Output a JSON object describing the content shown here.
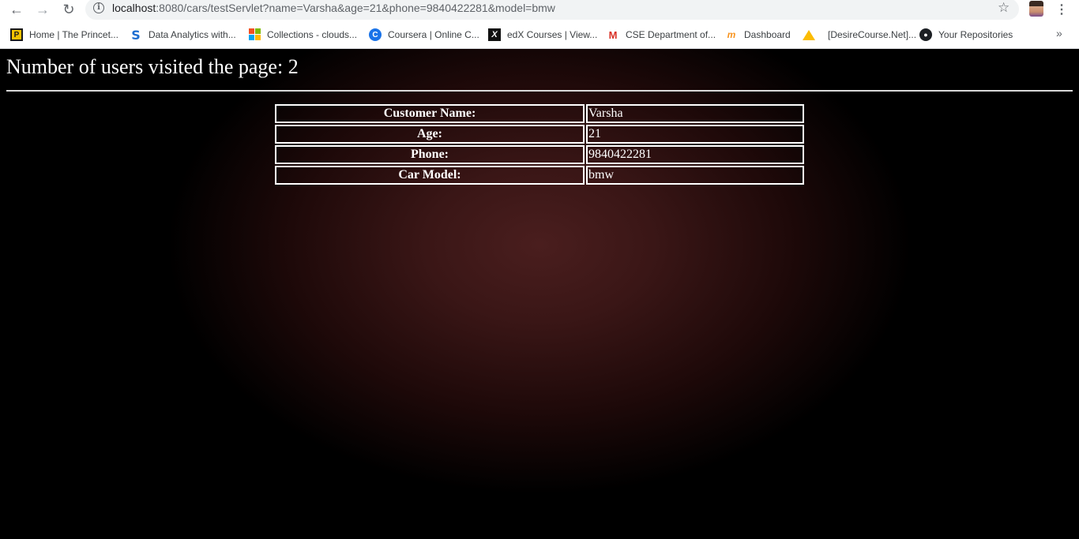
{
  "browser": {
    "url_host": "localhost",
    "url_rest": ":8080/cars/testServlet?name=Varsha&age=21&phone=9840422281&model=bmw",
    "bookmarks": [
      {
        "label": "Home | The Princet...",
        "icon": "princeton-review-icon"
      },
      {
        "label": "Data Analytics with...",
        "icon": "s-logo-icon"
      },
      {
        "label": "Collections - clouds...",
        "icon": "microsoft-logo-icon"
      },
      {
        "label": "Coursera | Online C...",
        "icon": "coursera-icon"
      },
      {
        "label": "edX Courses | View...",
        "icon": "edx-icon"
      },
      {
        "label": "CSE Department of...",
        "icon": "gmail-icon"
      },
      {
        "label": "Dashboard",
        "icon": "moodle-icon"
      },
      {
        "label": "[DesireCourse.Net]...",
        "icon": "google-drive-icon"
      },
      {
        "label": "Your Repositories",
        "icon": "github-icon"
      }
    ]
  },
  "page": {
    "heading": "Number of users visited the page: 2",
    "rows": [
      {
        "label": "Customer Name:",
        "value": "Varsha"
      },
      {
        "label": "Age:",
        "value": "21"
      },
      {
        "label": "Phone:",
        "value": "9840422281"
      },
      {
        "label": "Car Model:",
        "value": "bmw"
      }
    ]
  },
  "colors": {
    "background_center": "#4a1e1e",
    "background_edge": "#000000",
    "text": "#ffffff"
  }
}
